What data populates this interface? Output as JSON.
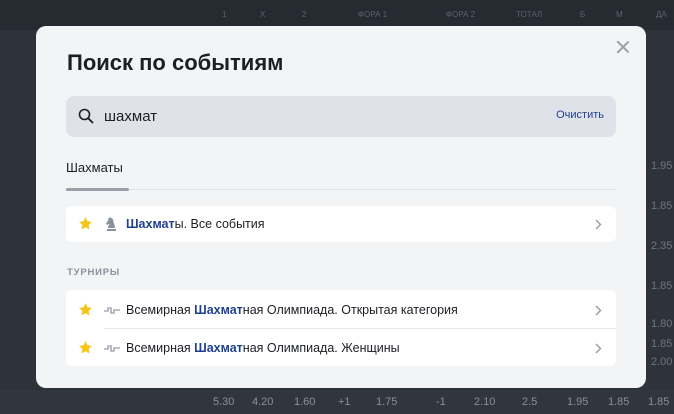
{
  "background": {
    "headers": [
      "1",
      "X",
      "2",
      "ФОРА 1",
      "ФОРА 2",
      "ТОТАЛ",
      "Б",
      "М",
      "ДА"
    ],
    "side_values": [
      "1.95",
      "1.85",
      "2.35",
      "1.85",
      "1.80",
      "1.85",
      "2.00"
    ],
    "bottom_row": [
      "5.30",
      "4.20",
      "1.60",
      "+1",
      "1.75",
      "-1",
      "2.10",
      "2.5",
      "1.95",
      "1.85",
      "1.85"
    ]
  },
  "modal": {
    "title": "Поиск по событиям",
    "search": {
      "value": "шахмат",
      "placeholder": "",
      "clear_label": "Очистить"
    },
    "tabs": [
      {
        "label": "Шахматы",
        "active": true
      }
    ],
    "sport_result": {
      "highlight": "Шахмат",
      "rest": "ы. Все события"
    },
    "tournaments_heading": "ТУРНИРЫ",
    "tournaments": [
      {
        "before": "Всемирная ",
        "highlight": "Шахмат",
        "after": "ная Олимпиада. Открытая категория"
      },
      {
        "before": "Всемирная ",
        "highlight": "Шахмат",
        "after": "ная Олимпиада. Женщины"
      }
    ]
  },
  "colors": {
    "accent": "#1f3f8f",
    "star": "#f5c518",
    "modal_bg": "#f3f4f6",
    "search_bg": "#dfe3e9"
  },
  "icons": {
    "close": "close-icon",
    "search": "search-icon",
    "star": "star-icon",
    "chess": "chess-knight-icon",
    "tournament": "trophy-icon",
    "chevron": "chevron-right-icon"
  }
}
